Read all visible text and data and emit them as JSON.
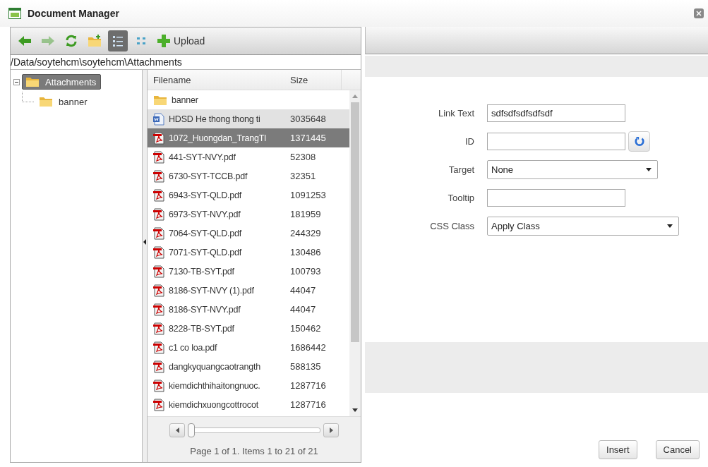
{
  "window": {
    "title": "Document Manager"
  },
  "toolbar": [
    {
      "kind": "back",
      "disabled": false,
      "selected": false
    },
    {
      "kind": "forward",
      "disabled": true,
      "selected": false
    },
    {
      "kind": "refresh",
      "disabled": false,
      "selected": false
    },
    {
      "kind": "new-folder",
      "disabled": false,
      "selected": false
    },
    {
      "kind": "list-view",
      "disabled": false,
      "selected": true
    },
    {
      "kind": "thumbnail-view",
      "disabled": false,
      "selected": false
    },
    {
      "kind": "upload",
      "label": "Upload",
      "disabled": false,
      "selected": false
    }
  ],
  "path": "/Data/soytehcm\\soytehcm\\Attachments",
  "tree": [
    {
      "label": "Attachments",
      "expanded": true,
      "selected": true,
      "children": [
        {
          "label": "banner",
          "selected": false
        }
      ]
    }
  ],
  "file_list": {
    "columns": [
      "Filename",
      "Size"
    ],
    "rows": [
      {
        "kind": "folder",
        "name": "banner",
        "selected": false,
        "hovered": false
      },
      {
        "kind": "word",
        "name": "HDSD He thong thong ti",
        "size": "3035648",
        "selected": false,
        "hovered": true
      },
      {
        "kind": "pdf",
        "name": "1072_Huongdan_TrangTl",
        "size": "1371445",
        "selected": true,
        "hovered": false
      },
      {
        "kind": "pdf",
        "name": "441-SYT-NVY.pdf",
        "size": "52308",
        "selected": false,
        "hovered": false
      },
      {
        "kind": "pdf",
        "name": "6730-SYT-TCCB.pdf",
        "size": "32351",
        "selected": false,
        "hovered": false
      },
      {
        "kind": "pdf",
        "name": "6943-SYT-QLD.pdf",
        "size": "1091253",
        "selected": false,
        "hovered": false
      },
      {
        "kind": "pdf",
        "name": "6973-SYT-NVY.pdf",
        "size": "181959",
        "selected": false,
        "hovered": false
      },
      {
        "kind": "pdf",
        "name": "7064-SYT-QLD.pdf",
        "size": "244329",
        "selected": false,
        "hovered": false
      },
      {
        "kind": "pdf",
        "name": "7071-SYT-QLD.pdf",
        "size": "130486",
        "selected": false,
        "hovered": false
      },
      {
        "kind": "pdf",
        "name": "7130-TB-SYT.pdf",
        "size": "100793",
        "selected": false,
        "hovered": false
      },
      {
        "kind": "pdf",
        "name": "8186-SYT-NVY (1).pdf",
        "size": "44047",
        "selected": false,
        "hovered": false
      },
      {
        "kind": "pdf",
        "name": "8186-SYT-NVY.pdf",
        "size": "44047",
        "selected": false,
        "hovered": false
      },
      {
        "kind": "pdf",
        "name": "8228-TB-SYT.pdf",
        "size": "150462",
        "selected": false,
        "hovered": false
      },
      {
        "kind": "pdf",
        "name": "c1 co loa.pdf",
        "size": "1686442",
        "selected": false,
        "hovered": false
      },
      {
        "kind": "pdf",
        "name": "dangkyquangcaotrangth",
        "size": "588135",
        "selected": false,
        "hovered": false
      },
      {
        "kind": "pdf",
        "name": "kiemdichthihaitongnuoc.",
        "size": "1287716",
        "selected": false,
        "hovered": false
      },
      {
        "kind": "pdf",
        "name": "kiemdichxuongcottrocot",
        "size": "1287716",
        "selected": false,
        "hovered": false
      }
    ],
    "pager": {
      "level": 0,
      "status": "Page 1 of 1. Items 1 to 21 of 21"
    }
  },
  "form": [
    {
      "kind": "text",
      "label": "Link Text",
      "value": "sdfsdfsdfsdfsdf"
    },
    {
      "kind": "text-with-button",
      "label": "ID"
    },
    {
      "kind": "select",
      "label": "Target",
      "value": "None"
    },
    {
      "kind": "text",
      "label": "Tooltip"
    },
    {
      "kind": "select",
      "label": "CSS Class",
      "value": "Apply Class"
    }
  ],
  "buttons": [
    "Insert",
    "Cancel"
  ]
}
